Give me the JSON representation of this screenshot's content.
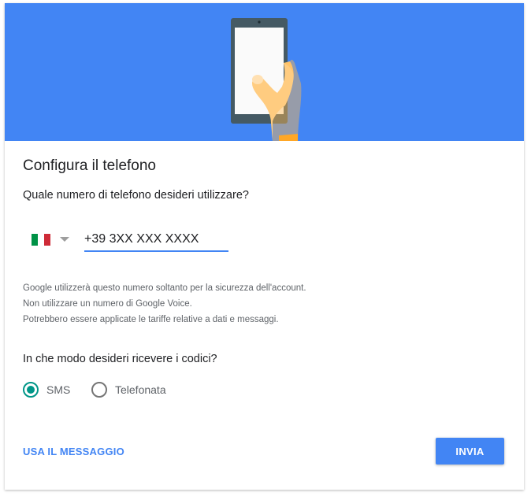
{
  "header": {
    "illustration": "phone-in-hand-illustration"
  },
  "title": "Configura il telefono",
  "question": "Quale numero di telefono desideri utilizzare?",
  "phone": {
    "country_flag": "italy-flag-icon",
    "value": "+39 3XX XXX XXXX"
  },
  "help_lines": [
    "Google utilizzerà questo numero soltanto per la sicurezza dell'account.",
    "Non utilizzare un numero di Google Voice.",
    "Potrebbero essere applicate le tariffe relative a dati e messaggi."
  ],
  "codes_question": "In che modo desideri ricevere i codici?",
  "delivery_options": [
    {
      "label": "SMS",
      "selected": true
    },
    {
      "label": "Telefonata",
      "selected": false
    }
  ],
  "actions": {
    "use_message": "USA IL MESSAGGIO",
    "send": "INVIA"
  },
  "colors": {
    "banner": "#4285f4",
    "accent": "#4285f4",
    "radio_selected": "#009688"
  }
}
